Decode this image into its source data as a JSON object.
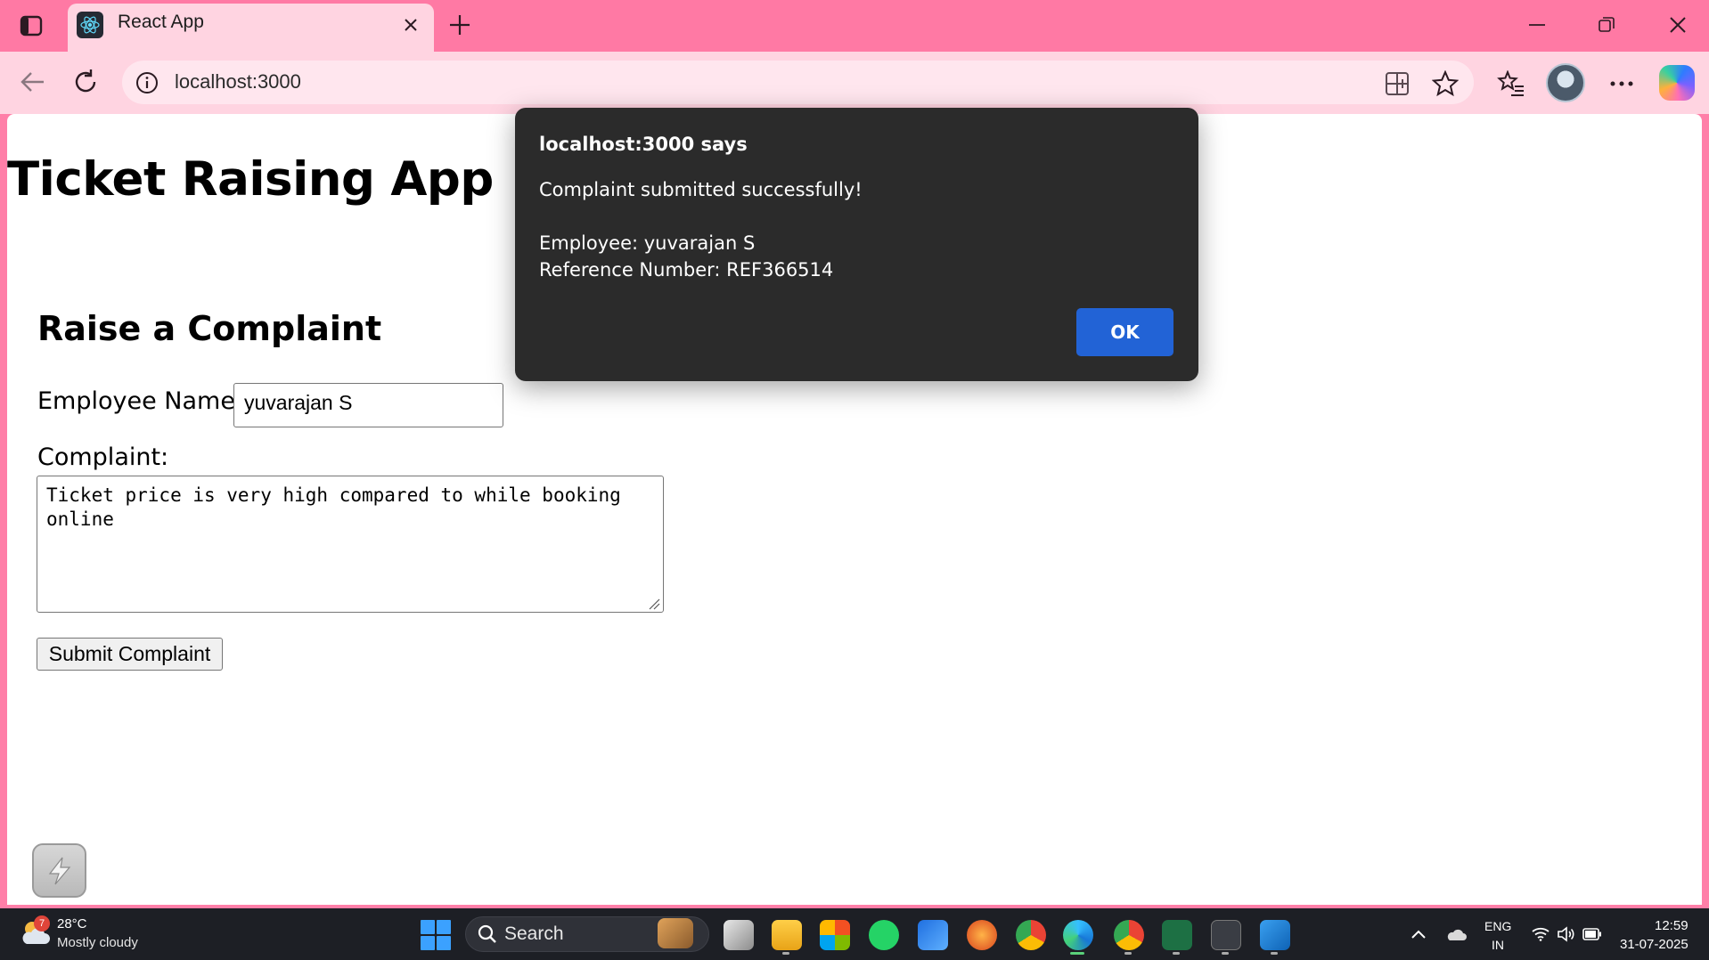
{
  "browser": {
    "tab_title": "React App",
    "url": "localhost:3000"
  },
  "page": {
    "app_title": "Ticket Raising App",
    "form_heading": "Raise a Complaint",
    "employee_label": "Employee Name:",
    "employee_value": "yuvarajan S",
    "complaint_label": "Complaint:",
    "complaint_value": "Ticket price is very high compared to while booking online",
    "submit_label": "Submit Complaint"
  },
  "alert": {
    "title": "localhost:3000 says",
    "message": "Complaint submitted successfully!\n\nEmployee: yuvarajan S\nReference Number: REF366514",
    "ok_label": "OK"
  },
  "taskbar": {
    "weather_badge": "7",
    "weather_temp": "28°C",
    "weather_desc": "Mostly cloudy",
    "search_label": "Search",
    "lang_line1": "ENG",
    "lang_line2": "IN",
    "time": "12:59",
    "date": "31-07-2025"
  },
  "colors": {
    "browser_frame": "#ff79a4",
    "toolbar": "#ffd4e1",
    "dialog_bg": "#2b2b2b",
    "ok_button": "#2263d6",
    "taskbar": "#1d1f25"
  },
  "icons": [
    "tab-actions-icon",
    "react-favicon",
    "close-icon",
    "plus-icon",
    "minimize-icon",
    "restore-icon",
    "back-arrow-icon",
    "reload-icon",
    "info-icon",
    "split-screen-icon",
    "star-icon",
    "favorites-icon",
    "more-icon",
    "copilot-icon",
    "windows-start-icon",
    "search-icon",
    "wifi-icon",
    "volume-icon",
    "battery-icon"
  ]
}
